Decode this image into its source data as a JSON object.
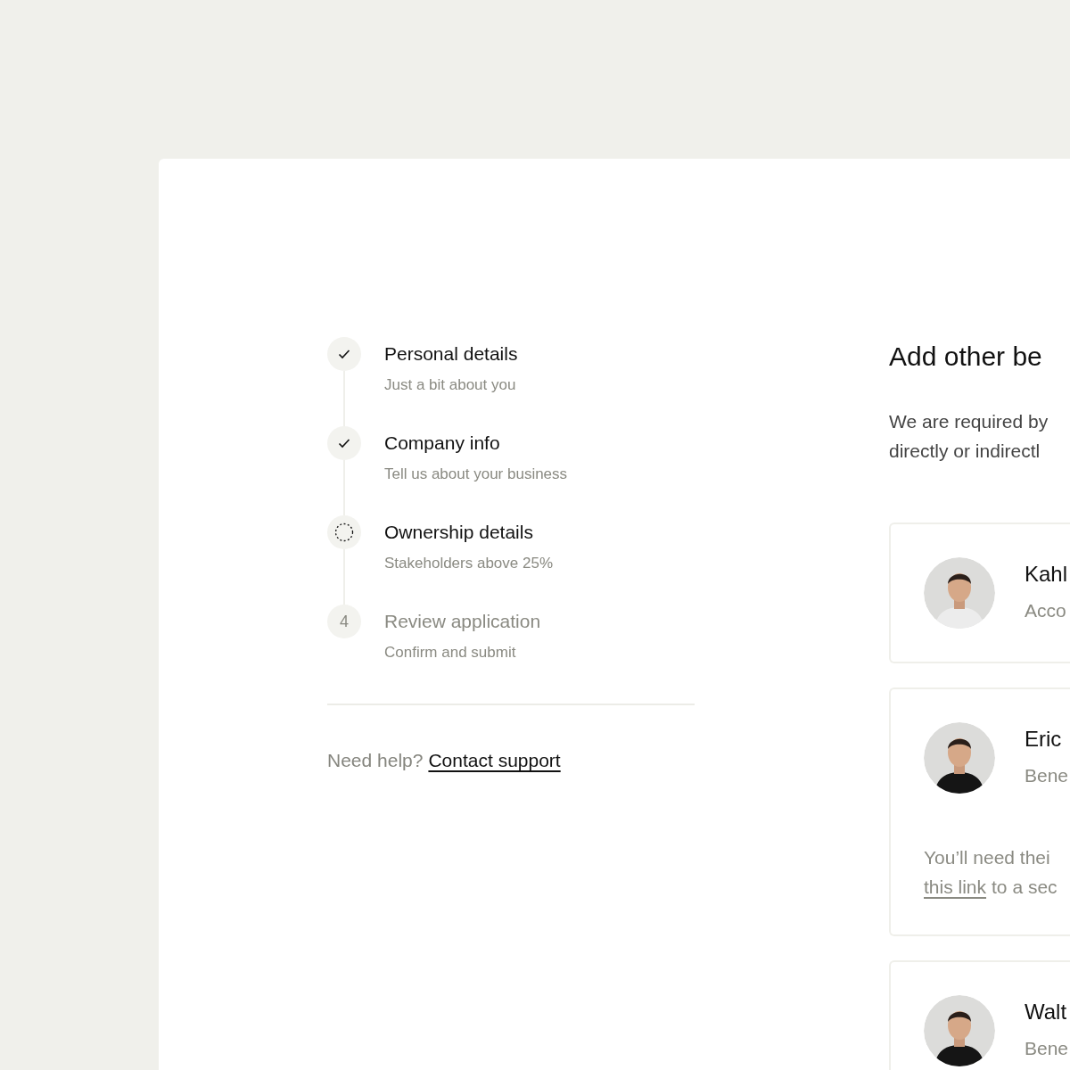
{
  "steps": [
    {
      "kind": "done",
      "title": "Personal details",
      "subtitle": "Just a bit about you"
    },
    {
      "kind": "done",
      "title": "Company info",
      "subtitle": "Tell us about your business"
    },
    {
      "kind": "current",
      "title": "Ownership details",
      "subtitle": "Stakeholders above 25%"
    },
    {
      "kind": "upcoming",
      "number": "4",
      "title": "Review application",
      "subtitle": "Confirm and submit"
    }
  ],
  "help": {
    "text": "Need help?",
    "link": "Contact support"
  },
  "heading": "Add other be",
  "description": [
    "We are required by",
    "directly or indirectl"
  ],
  "owners": [
    {
      "name": "Kahl",
      "role": "Acco"
    },
    {
      "name": "Eric",
      "role": "Bene",
      "note": "You’ll need thei",
      "note_link": "this link",
      "note_rest": "to a sec"
    },
    {
      "name": "Walt",
      "role": "Bene"
    }
  ]
}
